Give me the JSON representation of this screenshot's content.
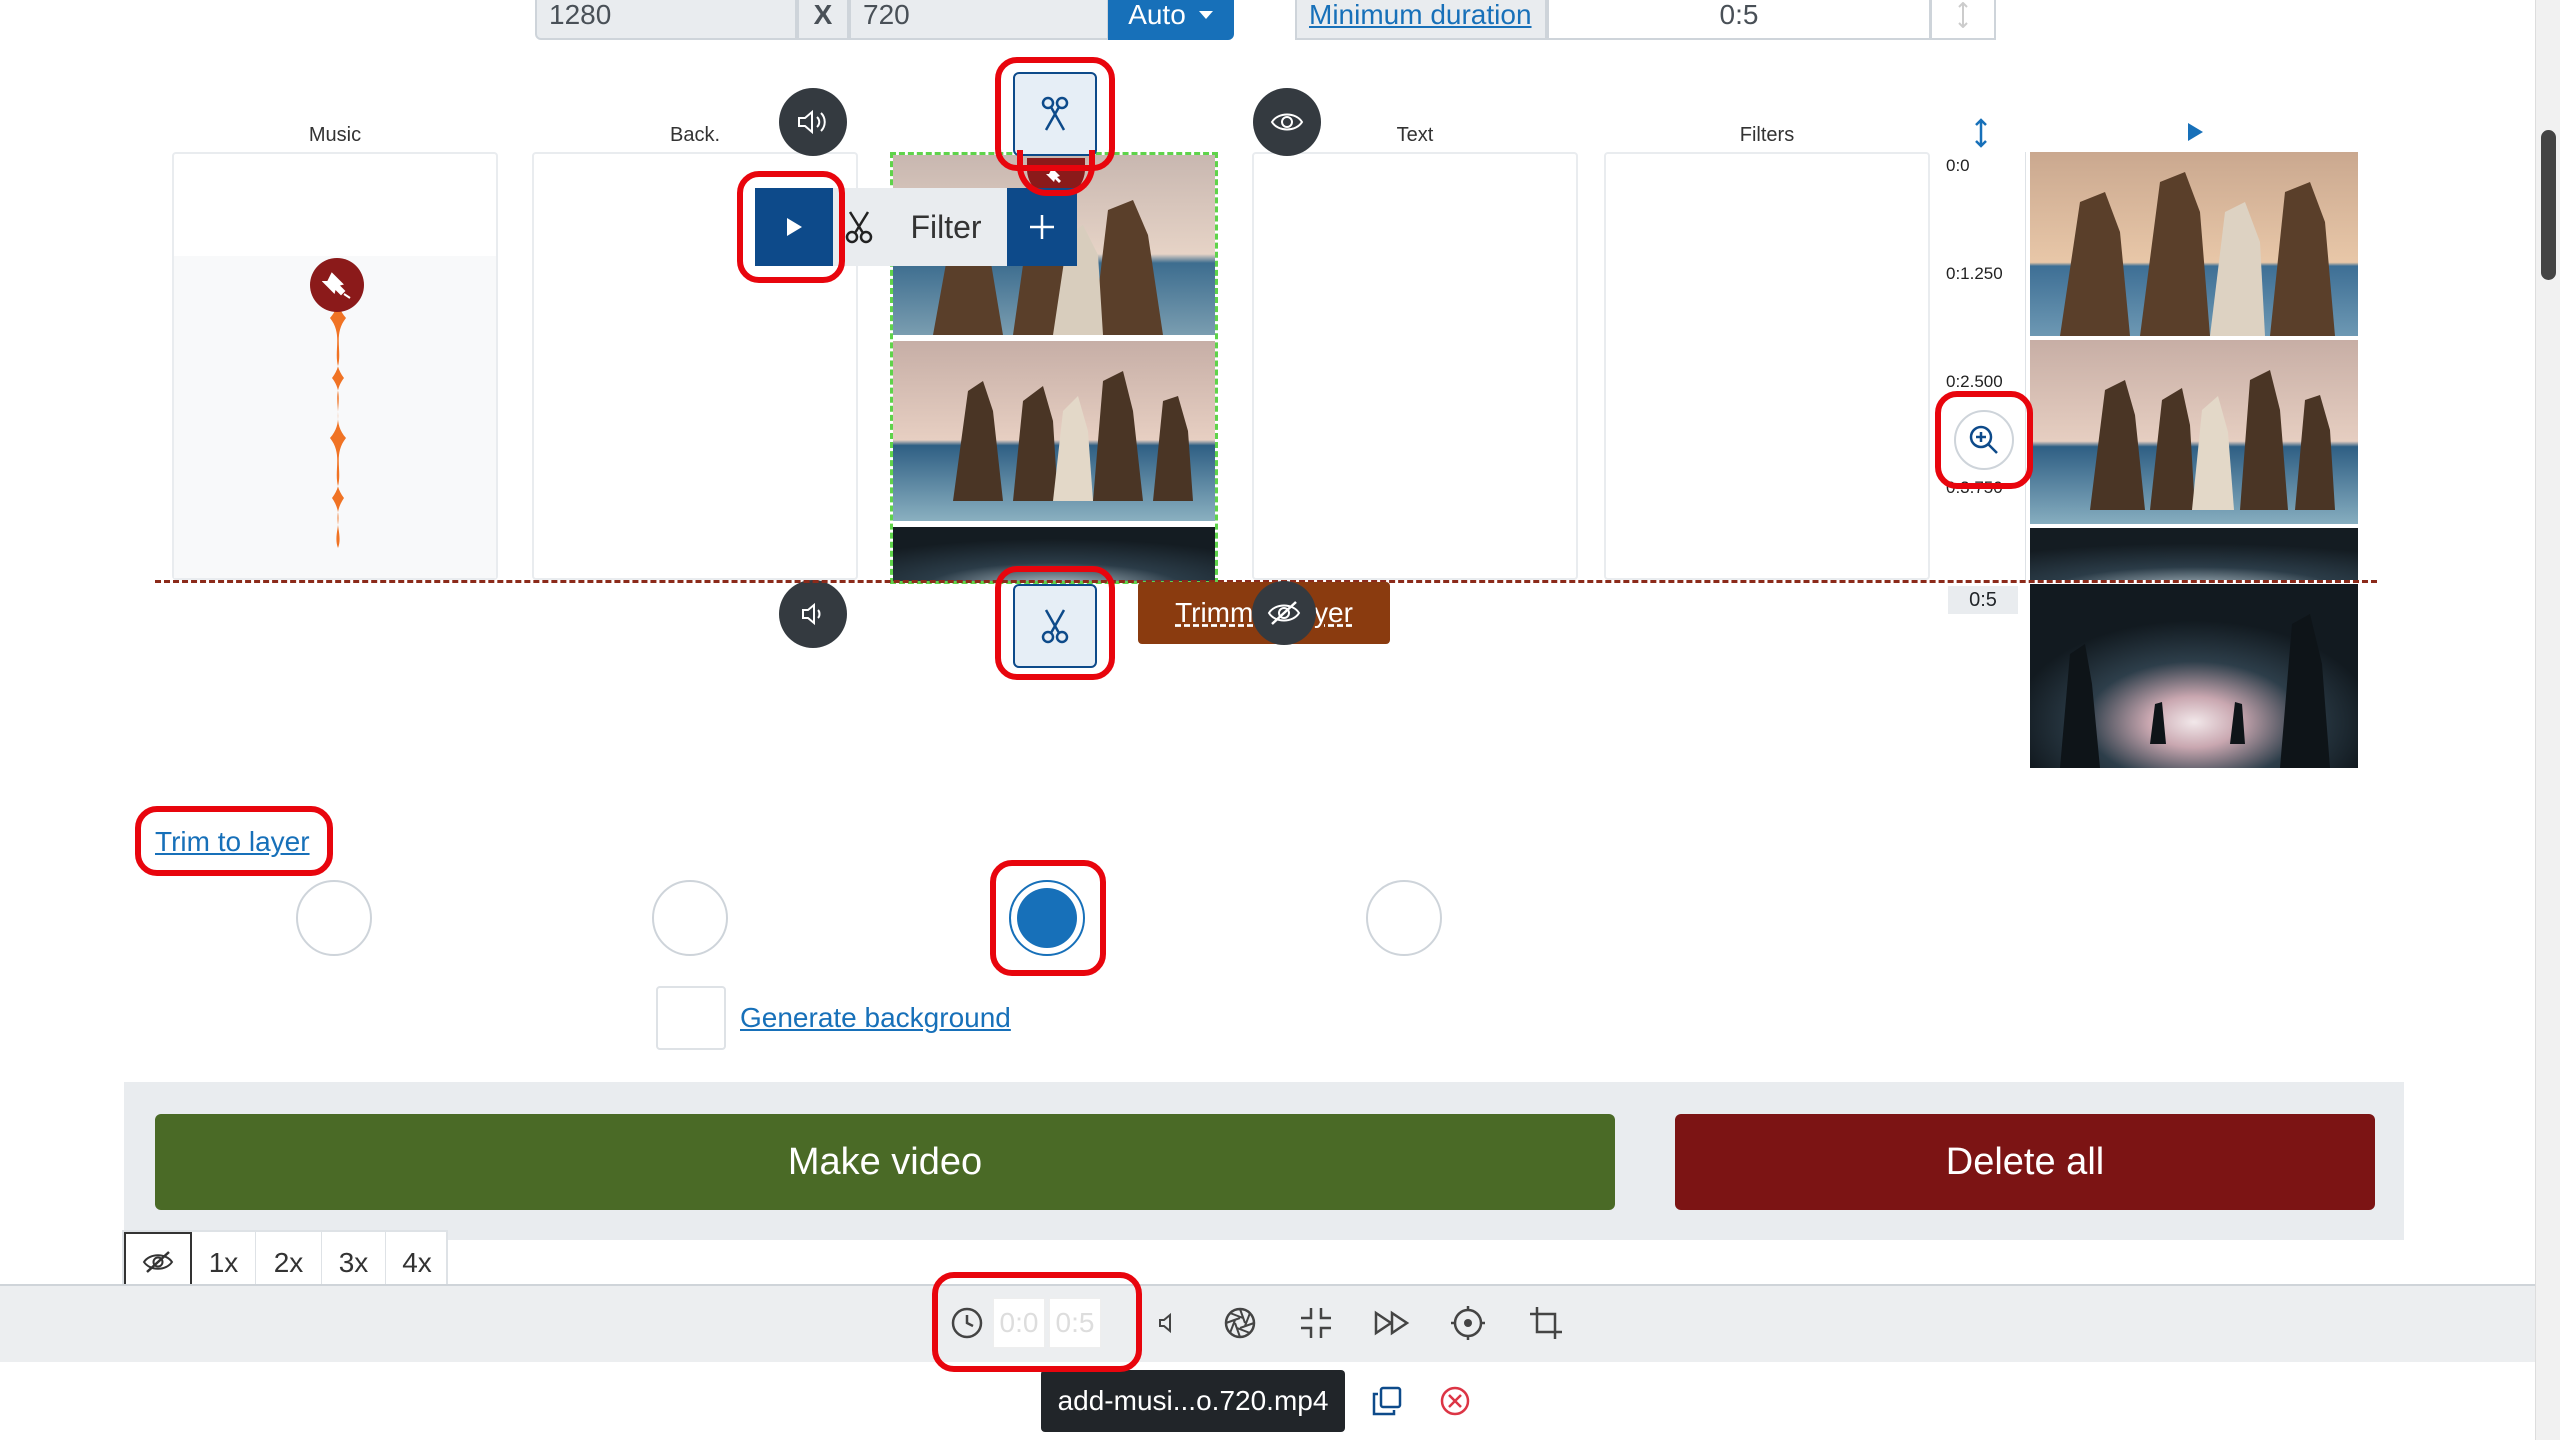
{
  "size": {
    "width": "1280",
    "height": "720",
    "separator": "X",
    "auto_label": "Auto"
  },
  "duration": {
    "label": "Minimum duration",
    "value": "0:5"
  },
  "columns": {
    "music": "Music",
    "back": "Back.",
    "text": "Text",
    "filters": "Filters"
  },
  "popup": {
    "filter_label": "Filter"
  },
  "trimmed_label": "Trimmed layer",
  "ruler": {
    "ticks": [
      "0:0",
      "0:1.250",
      "0:2.500",
      "0:3.750"
    ],
    "end": "0:5"
  },
  "trim_link": "Trim to layer",
  "generate_bg": "Generate background",
  "actions": {
    "make_video": "Make video",
    "delete_all": "Delete all"
  },
  "speeds": [
    "1x",
    "2x",
    "3x",
    "4x"
  ],
  "toolbar": {
    "time_start": "0:0",
    "time_end": "0:5"
  },
  "file": {
    "name": "add-musi...o.720.mp4"
  },
  "colors": {
    "primary": "#0d4a8a",
    "green": "#4a6a26",
    "red": "#7c1414",
    "orange": "#8a3b0f",
    "highlight": "#e8050d"
  }
}
